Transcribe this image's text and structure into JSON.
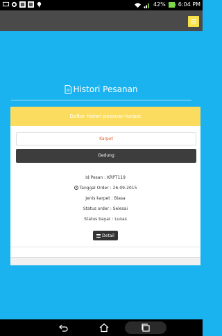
{
  "status_bar": {
    "battery": "42%",
    "time": "6:04 PM"
  },
  "header": {
    "title": "Histori Pesanan"
  },
  "card": {
    "heading": "Daftar histori pesanan karpet",
    "tab_karpet": "Karpet",
    "tab_gedung": "Gedung",
    "order": {
      "id": "Id Pesan : KRPT119",
      "date": "Tanggal Order : 26-09-2015",
      "type": "Jenis karpet : Biasa",
      "status": "Status order : Selesai",
      "payment": "Status bayar : Lunas"
    },
    "detail_button": "Detail"
  }
}
